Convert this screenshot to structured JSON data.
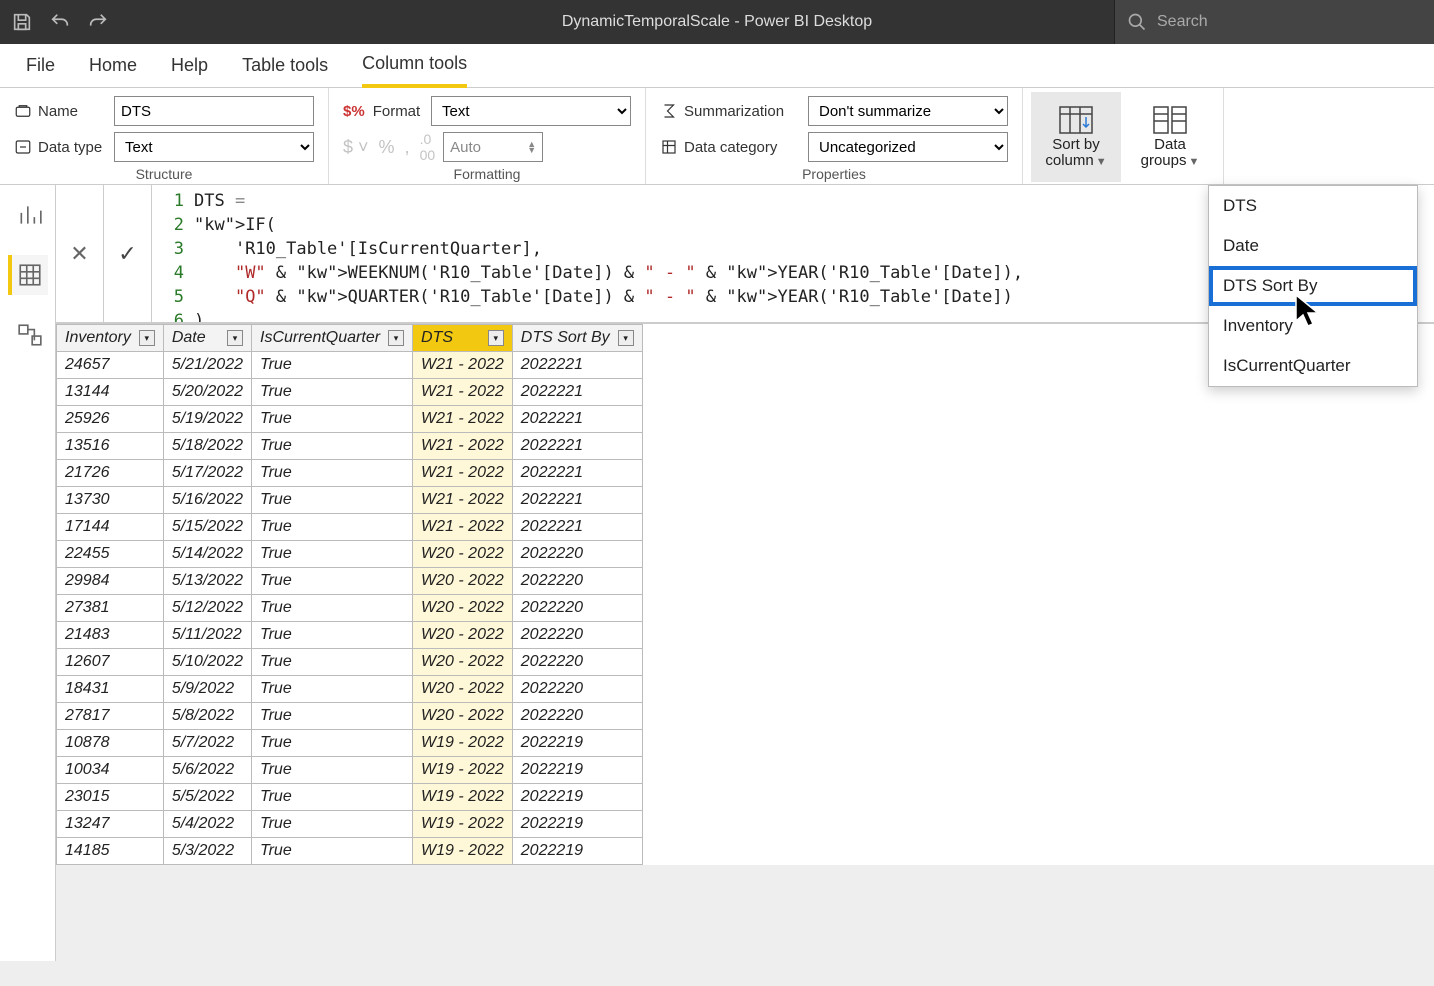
{
  "titlebar": {
    "title": "DynamicTemporalScale - Power BI Desktop",
    "search_placeholder": "Search"
  },
  "menu": {
    "file": "File",
    "home": "Home",
    "help": "Help",
    "table_tools": "Table tools",
    "column_tools": "Column tools"
  },
  "ribbon": {
    "structure": {
      "label": "Structure",
      "name_label": "Name",
      "name_value": "DTS",
      "datatype_label": "Data type",
      "datatype_value": "Text"
    },
    "formatting": {
      "label": "Formatting",
      "format_label": "Format",
      "format_value": "Text",
      "auto_label": "Auto"
    },
    "properties": {
      "label": "Properties",
      "summarization_label": "Summarization",
      "summarization_value": "Don't summarize",
      "data_category_label": "Data category",
      "data_category_value": "Uncategorized"
    },
    "actions": {
      "sort_by_column": "Sort by\ncolumn",
      "data_groups": "Data\ngroups"
    }
  },
  "formula": {
    "name": "DTS",
    "lines": [
      "DTS =",
      "IF(",
      "    'R10_Table'[IsCurrentQuarter],",
      "    \"W\" & WEEKNUM('R10_Table'[Date]) & \" - \" & YEAR('R10_Table'[Date]),",
      "    \"Q\" & QUARTER('R10_Table'[Date]) & \" - \" & YEAR('R10_Table'[Date])",
      ")"
    ]
  },
  "columns": [
    "Inventory",
    "Date",
    "IsCurrentQuarter",
    "DTS",
    "DTS Sort By"
  ],
  "selected_column": "DTS",
  "rows": [
    {
      "Inventory": 24657,
      "Date": "5/21/2022",
      "IsCurrentQuarter": "True",
      "DTS": "W21 - 2022",
      "DTS Sort By": "2022221"
    },
    {
      "Inventory": 13144,
      "Date": "5/20/2022",
      "IsCurrentQuarter": "True",
      "DTS": "W21 - 2022",
      "DTS Sort By": "2022221"
    },
    {
      "Inventory": 25926,
      "Date": "5/19/2022",
      "IsCurrentQuarter": "True",
      "DTS": "W21 - 2022",
      "DTS Sort By": "2022221"
    },
    {
      "Inventory": 13516,
      "Date": "5/18/2022",
      "IsCurrentQuarter": "True",
      "DTS": "W21 - 2022",
      "DTS Sort By": "2022221"
    },
    {
      "Inventory": 21726,
      "Date": "5/17/2022",
      "IsCurrentQuarter": "True",
      "DTS": "W21 - 2022",
      "DTS Sort By": "2022221"
    },
    {
      "Inventory": 13730,
      "Date": "5/16/2022",
      "IsCurrentQuarter": "True",
      "DTS": "W21 - 2022",
      "DTS Sort By": "2022221"
    },
    {
      "Inventory": 17144,
      "Date": "5/15/2022",
      "IsCurrentQuarter": "True",
      "DTS": "W21 - 2022",
      "DTS Sort By": "2022221"
    },
    {
      "Inventory": 22455,
      "Date": "5/14/2022",
      "IsCurrentQuarter": "True",
      "DTS": "W20 - 2022",
      "DTS Sort By": "2022220"
    },
    {
      "Inventory": 29984,
      "Date": "5/13/2022",
      "IsCurrentQuarter": "True",
      "DTS": "W20 - 2022",
      "DTS Sort By": "2022220"
    },
    {
      "Inventory": 27381,
      "Date": "5/12/2022",
      "IsCurrentQuarter": "True",
      "DTS": "W20 - 2022",
      "DTS Sort By": "2022220"
    },
    {
      "Inventory": 21483,
      "Date": "5/11/2022",
      "IsCurrentQuarter": "True",
      "DTS": "W20 - 2022",
      "DTS Sort By": "2022220"
    },
    {
      "Inventory": 12607,
      "Date": "5/10/2022",
      "IsCurrentQuarter": "True",
      "DTS": "W20 - 2022",
      "DTS Sort By": "2022220"
    },
    {
      "Inventory": 18431,
      "Date": "5/9/2022",
      "IsCurrentQuarter": "True",
      "DTS": "W20 - 2022",
      "DTS Sort By": "2022220"
    },
    {
      "Inventory": 27817,
      "Date": "5/8/2022",
      "IsCurrentQuarter": "True",
      "DTS": "W20 - 2022",
      "DTS Sort By": "2022220"
    },
    {
      "Inventory": 10878,
      "Date": "5/7/2022",
      "IsCurrentQuarter": "True",
      "DTS": "W19 - 2022",
      "DTS Sort By": "2022219"
    },
    {
      "Inventory": 10034,
      "Date": "5/6/2022",
      "IsCurrentQuarter": "True",
      "DTS": "W19 - 2022",
      "DTS Sort By": "2022219"
    },
    {
      "Inventory": 23015,
      "Date": "5/5/2022",
      "IsCurrentQuarter": "True",
      "DTS": "W19 - 2022",
      "DTS Sort By": "2022219"
    },
    {
      "Inventory": 13247,
      "Date": "5/4/2022",
      "IsCurrentQuarter": "True",
      "DTS": "W19 - 2022",
      "DTS Sort By": "2022219"
    },
    {
      "Inventory": 14185,
      "Date": "5/3/2022",
      "IsCurrentQuarter": "True",
      "DTS": "W19 - 2022",
      "DTS Sort By": "2022219"
    }
  ],
  "sort_dropdown": {
    "items": [
      "DTS",
      "Date",
      "DTS Sort By",
      "Inventory",
      "IsCurrentQuarter"
    ],
    "highlighted": "DTS Sort By"
  }
}
